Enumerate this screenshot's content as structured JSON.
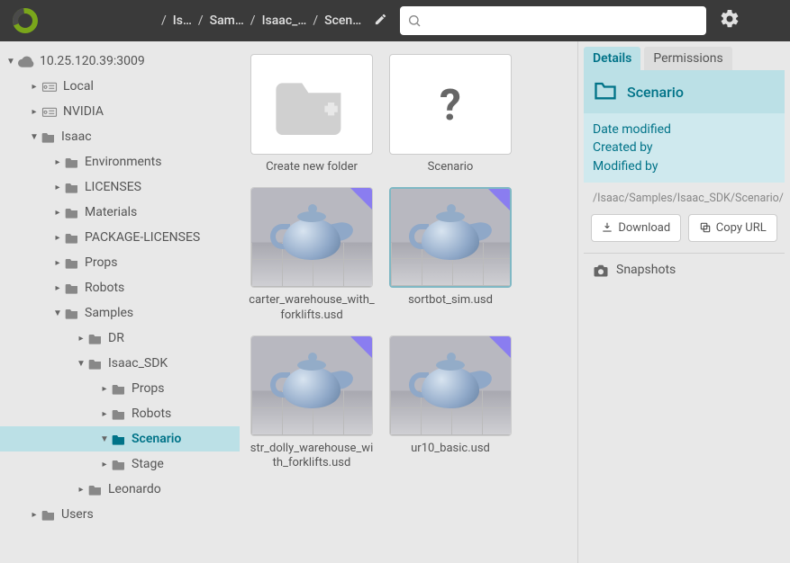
{
  "breadcrumb": [
    "Is…",
    "Sam…",
    "Isaac_…",
    "Scen…"
  ],
  "search": {
    "placeholder": ""
  },
  "tree": {
    "root": "10.25.120.39:3009",
    "items": [
      {
        "label": "Local",
        "depth": 1,
        "caret": "right",
        "icon": "drive"
      },
      {
        "label": "NVIDIA",
        "depth": 1,
        "caret": "right",
        "icon": "drive"
      },
      {
        "label": "Isaac",
        "depth": 1,
        "caret": "down",
        "icon": "folder"
      },
      {
        "label": "Environments",
        "depth": 2,
        "caret": "right",
        "icon": "folder"
      },
      {
        "label": "LICENSES",
        "depth": 2,
        "caret": "right",
        "icon": "folder"
      },
      {
        "label": "Materials",
        "depth": 2,
        "caret": "right",
        "icon": "folder"
      },
      {
        "label": "PACKAGE-LICENSES",
        "depth": 2,
        "caret": "right",
        "icon": "folder"
      },
      {
        "label": "Props",
        "depth": 2,
        "caret": "right",
        "icon": "folder"
      },
      {
        "label": "Robots",
        "depth": 2,
        "caret": "right",
        "icon": "folder"
      },
      {
        "label": "Samples",
        "depth": 2,
        "caret": "down",
        "icon": "folder"
      },
      {
        "label": "DR",
        "depth": 3,
        "caret": "right",
        "icon": "folder"
      },
      {
        "label": "Isaac_SDK",
        "depth": 3,
        "caret": "down",
        "icon": "folder"
      },
      {
        "label": "Props",
        "depth": 4,
        "caret": "right",
        "icon": "folder"
      },
      {
        "label": "Robots",
        "depth": 4,
        "caret": "right",
        "icon": "folder"
      },
      {
        "label": "Scenario",
        "depth": 4,
        "caret": "down",
        "icon": "folder",
        "selected": true
      },
      {
        "label": "Stage",
        "depth": 4,
        "caret": "right",
        "icon": "folder"
      },
      {
        "label": "Leonardo",
        "depth": 3,
        "caret": "right",
        "icon": "folder"
      },
      {
        "label": "Users",
        "depth": 1,
        "caret": "right",
        "icon": "folder"
      }
    ]
  },
  "items": [
    {
      "label": "Create new folder",
      "kind": "newfolder"
    },
    {
      "label": "Scenario",
      "kind": "unknown"
    },
    {
      "label": "carter_warehouse_with_forklifts.usd",
      "kind": "usd"
    },
    {
      "label": "sortbot_sim.usd",
      "kind": "usd",
      "selected": true
    },
    {
      "label": "str_dolly_warehouse_with_forklifts.usd",
      "kind": "usd"
    },
    {
      "label": "ur10_basic.usd",
      "kind": "usd"
    }
  ],
  "details": {
    "tabs": {
      "tab0": "Details",
      "tab1": "Permissions"
    },
    "title": "Scenario",
    "meta": {
      "dm": "Date modified",
      "cb": "Created by",
      "mb": "Modified by"
    },
    "path": "/Isaac/Samples/Isaac_SDK/Scenario/",
    "download": "Download",
    "copyurl": "Copy URL",
    "snapshots": "Snapshots"
  }
}
